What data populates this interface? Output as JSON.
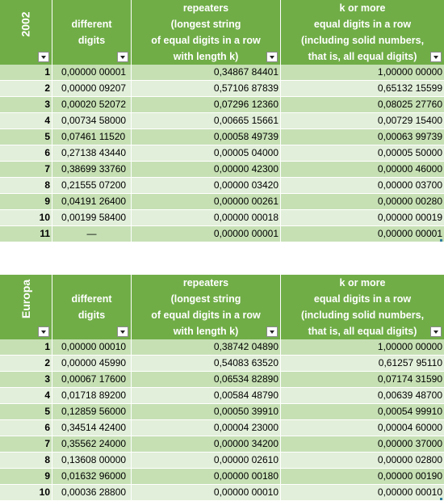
{
  "colors": {
    "header_green": "#70ad47",
    "band_light": "#e2efda",
    "band_mid": "#c6e0b4",
    "text_white": "#ffffff"
  },
  "tables": [
    {
      "label": "2002",
      "headers": [
        "",
        "different\ndigits",
        "repeaters\n(longest string\nof equal digits in a row\nwith length k)",
        "k or more\nequal digits in a row\n(including solid numbers,\nthat is, all equal digits)"
      ],
      "rows": [
        [
          "1",
          "0,00000 00001",
          "0,34867 84401",
          "1,00000 00000"
        ],
        [
          "2",
          "0,00000 09207",
          "0,57106 87839",
          "0,65132 15599"
        ],
        [
          "3",
          "0,00020 52072",
          "0,07296 12360",
          "0,08025 27760"
        ],
        [
          "4",
          "0,00734 58000",
          "0,00665 15661",
          "0,00729 15400"
        ],
        [
          "5",
          "0,07461 11520",
          "0,00058 49739",
          "0,00063 99739"
        ],
        [
          "6",
          "0,27138 43440",
          "0,00005 04000",
          "0,00005 50000"
        ],
        [
          "7",
          "0,38699 33760",
          "0,00000 42300",
          "0,00000 46000"
        ],
        [
          "8",
          "0,21555 07200",
          "0,00000 03420",
          "0,00000 03700"
        ],
        [
          "9",
          "0,04191 26400",
          "0,00000 00261",
          "0,00000 00280"
        ],
        [
          "10",
          "0,00199 58400",
          "0,00000 00018",
          "0,00000 00019"
        ],
        [
          "11",
          "—",
          "0,00000 00001",
          "0,00000 00001"
        ]
      ]
    },
    {
      "label": "Europa",
      "headers": [
        "",
        "different\ndigits",
        "repeaters\n(longest string\nof equal digits in a row\nwith length k)",
        "k or more\nequal digits in a row\n(including solid numbers,\nthat is, all equal digits)"
      ],
      "rows": [
        [
          "1",
          "0,00000 00010",
          "0,38742 04890",
          "1,00000 00000"
        ],
        [
          "2",
          "0,00000 45990",
          "0,54083 63520",
          "0,61257 95110"
        ],
        [
          "3",
          "0,00067 17600",
          "0,06534 82890",
          "0,07174 31590"
        ],
        [
          "4",
          "0,01718 89200",
          "0,00584 48790",
          "0,00639 48700"
        ],
        [
          "5",
          "0,12859 56000",
          "0,00050 39910",
          "0,00054 99910"
        ],
        [
          "6",
          "0,34514 42400",
          "0,00004 23000",
          "0,00004 60000"
        ],
        [
          "7",
          "0,35562 24000",
          "0,00000 34200",
          "0,00000 37000"
        ],
        [
          "8",
          "0,13608 00000",
          "0,00000 02610",
          "0,00000 02800"
        ],
        [
          "9",
          "0,01632 96000",
          "0,00000 00180",
          "0,00000 00190"
        ],
        [
          "10",
          "0,00036 28800",
          "0,00000 00010",
          "0,00000 00010"
        ]
      ]
    }
  ]
}
